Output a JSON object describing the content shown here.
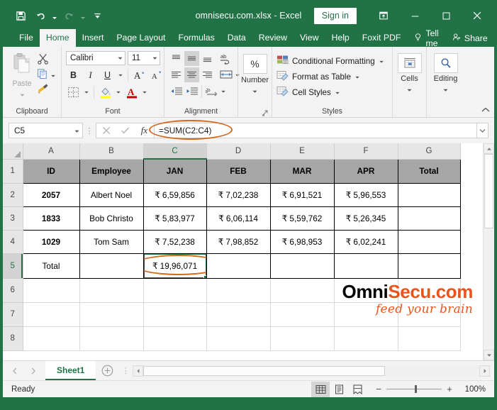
{
  "titlebar": {
    "document_title": "omnisecu.com.xlsx  -  Excel",
    "signin_label": "Sign in",
    "qat": [
      {
        "name": "save-icon",
        "label": "Save"
      },
      {
        "name": "undo-icon",
        "label": "Undo"
      },
      {
        "name": "redo-icon",
        "label": "Redo"
      },
      {
        "name": "customize-quick-access-toolbar-icon",
        "label": "Customize Quick Access Toolbar"
      }
    ],
    "window_controls": [
      {
        "name": "ribbon-display-options-icon",
        "label": "Ribbon Display Options"
      },
      {
        "name": "minimize-icon",
        "label": "Minimize"
      },
      {
        "name": "maximize-icon",
        "label": "Maximize"
      },
      {
        "name": "close-icon",
        "label": "Close"
      }
    ]
  },
  "tabs": [
    {
      "label": "File",
      "active": false
    },
    {
      "label": "Home",
      "active": true
    },
    {
      "label": "Insert",
      "active": false
    },
    {
      "label": "Page Layout",
      "active": false
    },
    {
      "label": "Formulas",
      "active": false
    },
    {
      "label": "Data",
      "active": false
    },
    {
      "label": "Review",
      "active": false
    },
    {
      "label": "View",
      "active": false
    },
    {
      "label": "Help",
      "active": false
    },
    {
      "label": "Foxit PDF",
      "active": false
    }
  ],
  "tabs_right": {
    "tell_me": "Tell me",
    "share": "Share"
  },
  "ribbon": {
    "clipboard": {
      "group_label": "Clipboard",
      "paste_label": "Paste",
      "cut_label": "Cut",
      "copy_label": "Copy",
      "format_painter_label": "Format Painter"
    },
    "font": {
      "group_label": "Font",
      "font_name": "Calibri",
      "font_size": "11",
      "bold": "B",
      "italic": "I",
      "underline": "U",
      "grow_font": "A",
      "shrink_font": "A"
    },
    "alignment": {
      "group_label": "Alignment"
    },
    "number": {
      "group_label": "Number",
      "percent_label": "%"
    },
    "styles": {
      "group_label": "Styles",
      "conditional_formatting": "Conditional Formatting",
      "format_as_table": "Format as Table",
      "cell_styles": "Cell Styles"
    },
    "cells": {
      "group_label": "Cells"
    },
    "editing": {
      "group_label": "Editing"
    }
  },
  "formula_bar": {
    "name_box_value": "C5",
    "formula_value": "=SUM(C2:C4)",
    "cancel_label": "Cancel",
    "enter_label": "Enter",
    "insert_function_label": "fx"
  },
  "grid": {
    "column_headers": [
      "A",
      "B",
      "C",
      "D",
      "E",
      "F",
      "G"
    ],
    "selected_column": "C",
    "row_headers": [
      "1",
      "2",
      "3",
      "4",
      "5",
      "6",
      "7",
      "8"
    ],
    "selected_row": "5",
    "selected_cell": "C5",
    "header_row": [
      "ID",
      "Employee",
      "JAN",
      "FEB",
      "MAR",
      "APR",
      "Total"
    ],
    "rows": [
      {
        "id": "2057",
        "employee": "Albert Noel",
        "jan": "₹ 6,59,856",
        "feb": "₹ 7,02,238",
        "mar": "₹ 6,91,521",
        "apr": "₹ 5,96,553",
        "total": ""
      },
      {
        "id": "1833",
        "employee": "Bob Christo",
        "jan": "₹ 5,83,977",
        "feb": "₹ 6,06,114",
        "mar": "₹ 5,59,762",
        "apr": "₹ 5,26,345",
        "total": ""
      },
      {
        "id": "1029",
        "employee": "Tom Sam",
        "jan": "₹ 7,52,238",
        "feb": "₹ 7,98,852",
        "mar": "₹ 6,98,953",
        "apr": "₹ 6,02,241",
        "total": ""
      }
    ],
    "total_row": {
      "id": "Total",
      "employee": "",
      "jan": "₹ 19,96,071",
      "feb": "",
      "mar": "",
      "apr": "",
      "total": ""
    }
  },
  "watermark": {
    "brand_first": "Omni",
    "brand_second": "Secu.com",
    "tagline": "feed your brain"
  },
  "sheet_tabs": {
    "active_sheet": "Sheet1",
    "add_sheet_label": "New sheet"
  },
  "status_bar": {
    "status_text": "Ready",
    "zoom_value": "100%",
    "zoom_out_label": "−",
    "zoom_in_label": "+",
    "views": [
      {
        "name": "normal-view-icon",
        "label": "Normal",
        "selected": true
      },
      {
        "name": "page-layout-view-icon",
        "label": "Page Layout",
        "selected": false
      },
      {
        "name": "page-break-preview-icon",
        "label": "Page Break Preview",
        "selected": false
      }
    ]
  },
  "colors": {
    "excel_green": "#217346",
    "highlight_orange": "#d2691e",
    "brand_orange": "#e8551c",
    "header_gray": "#a6a6a6"
  }
}
